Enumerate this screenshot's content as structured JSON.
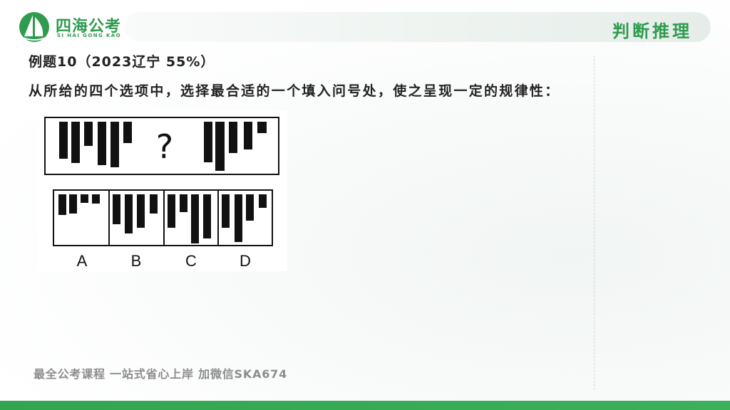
{
  "logo": {
    "name": "四海公考",
    "subtitle": "SI HAI GONG KAO",
    "icon": "sail-logo-icon"
  },
  "header": {
    "section": "判断推理"
  },
  "question": {
    "title": "例题10（2023辽宁  55%）",
    "prompt": "从所给的四个选项中，选择最合适的一个填入问号处，使之呈现一定的规律性："
  },
  "figure": {
    "question_mark": "?",
    "options": [
      "A",
      "B",
      "C",
      "D"
    ]
  },
  "footer": {
    "text": "最全公考课程 一站式省心上岸 加微信SKA674"
  },
  "colors": {
    "brand_green": "#2f9b4f",
    "bottom_bar": "#35a852",
    "footer_gray": "#8c8c8c"
  }
}
